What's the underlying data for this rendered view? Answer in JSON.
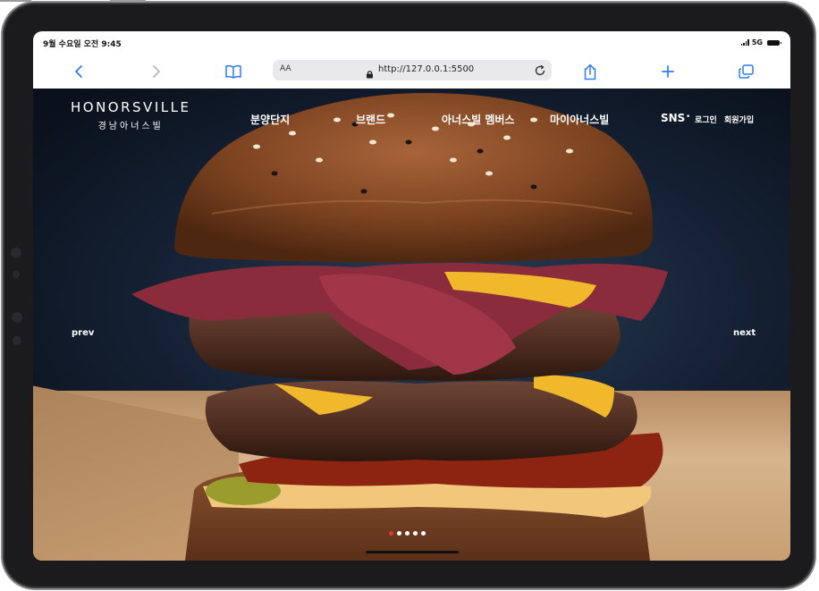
{
  "status": {
    "time": "9월 수요일 오전 9:45",
    "network": "5G"
  },
  "browser": {
    "aa_label": "AA",
    "url": "http://127.0.0.1:5500",
    "icons": [
      "back-icon",
      "forward-icon",
      "bookmarks-icon",
      "lock-icon",
      "reload-icon",
      "share-icon",
      "add-tab-icon",
      "tabs-icon"
    ]
  },
  "site": {
    "logo_main": "HONORSVILLE",
    "logo_sub": "경남아너스빌",
    "nav": [
      "분양단지",
      "브랜드",
      "아너스빌 멤버스",
      "마이아너스빌"
    ],
    "sns": "SNS",
    "sns_separator": "•",
    "login": "로그인",
    "signup": "회원가입",
    "prev": "prev",
    "next": "next"
  },
  "slider": {
    "total": 5,
    "active_index": 0
  },
  "colors": {
    "active_dot": "#e23b2f",
    "toolbar_icon": "#2f7bf5"
  }
}
